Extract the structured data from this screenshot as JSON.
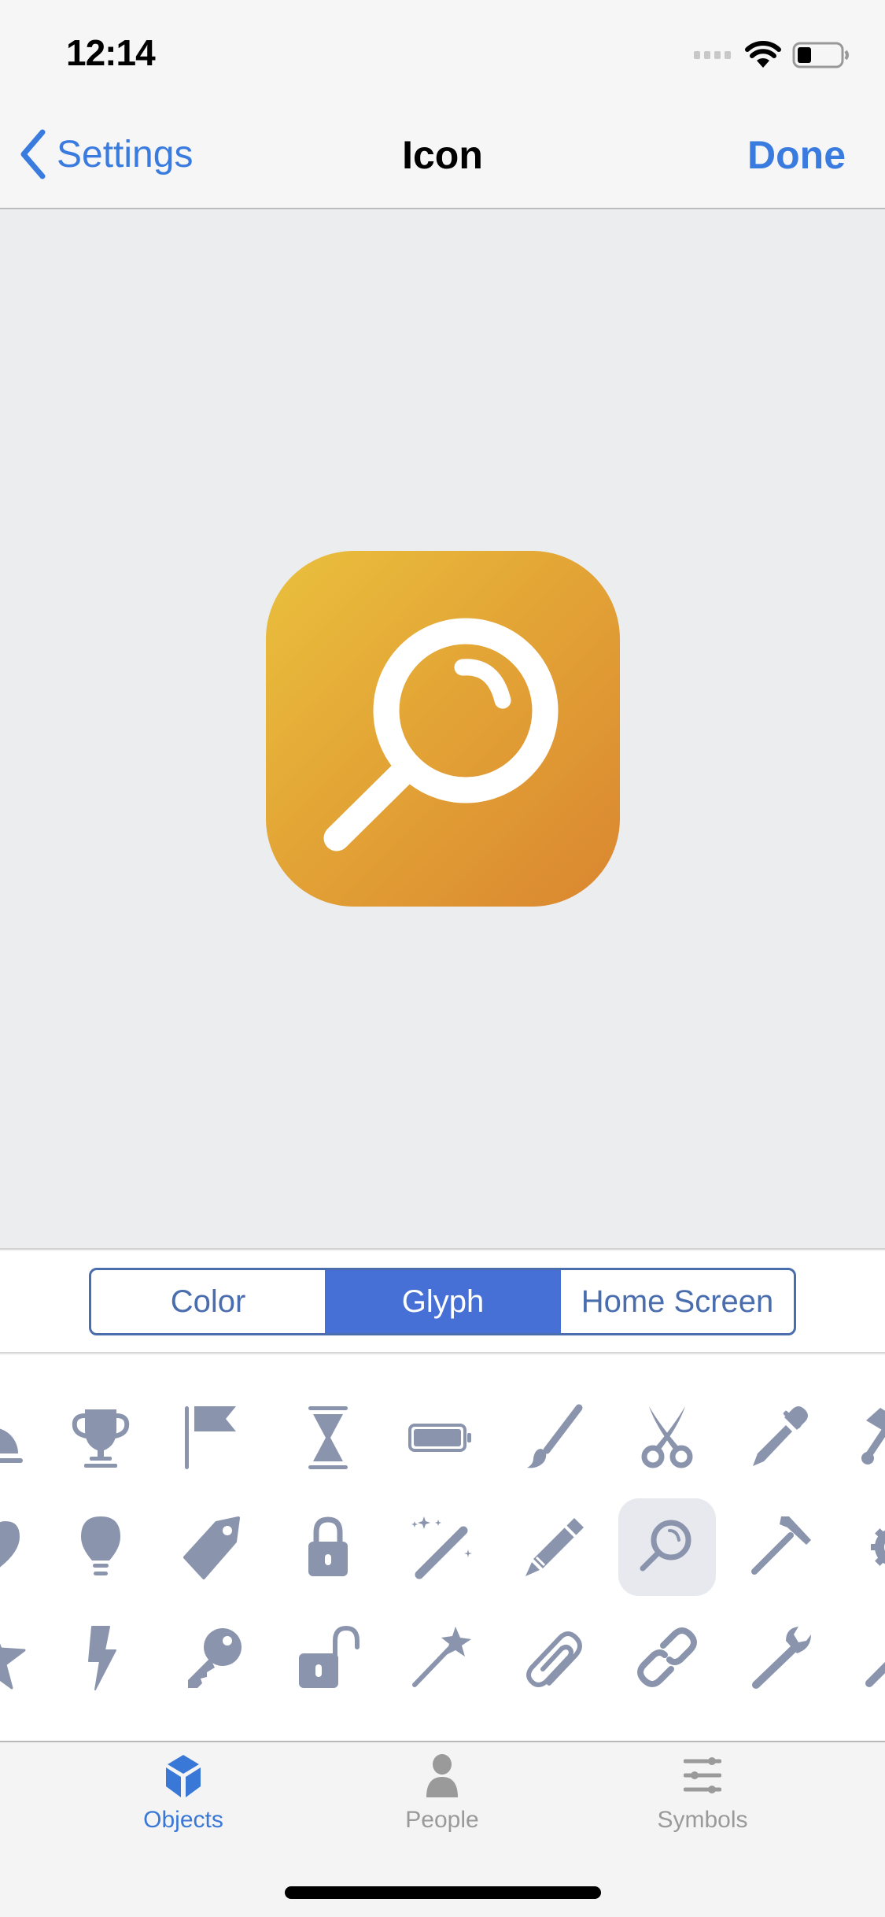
{
  "status_bar": {
    "time": "12:14",
    "signal_icon": "cellular-signal-icon",
    "wifi_icon": "wifi-icon",
    "battery_icon": "battery-icon",
    "battery_level_percent": 30
  },
  "nav": {
    "back_label": "Settings",
    "back_icon": "chevron-left-icon",
    "title": "Icon",
    "done_label": "Done"
  },
  "preview": {
    "glyph": "magnifying-glass-icon",
    "gradient_colors": [
      "#EAC03D",
      "#DA8630"
    ],
    "glyph_color": "#FFFFFF"
  },
  "segmented_control": {
    "options": [
      "Color",
      "Glyph",
      "Home Screen"
    ],
    "selected": "Glyph",
    "accent_color": "#4670D6"
  },
  "glyph_grid": {
    "glyph_color": "#8A95AD",
    "selected": "magnifying-glass",
    "rows": [
      [
        "service-bell",
        "trophy",
        "flag",
        "hourglass",
        "battery",
        "paintbrush",
        "scissors",
        "eyedropper",
        "hammer-partial"
      ],
      [
        "heart",
        "lightbulb",
        "tag",
        "lock",
        "magic-wand-sparkles",
        "pencil",
        "magnifying-glass",
        "hammer",
        "gear"
      ],
      [
        "star",
        "lightning-bolt",
        "key",
        "unlock",
        "magic-wand-star",
        "paperclip",
        "link",
        "wrench",
        "screwdriver"
      ]
    ]
  },
  "tab_bar": {
    "tabs": [
      {
        "label": "Objects",
        "icon": "cube-icon",
        "active": true
      },
      {
        "label": "People",
        "icon": "person-icon",
        "active": false
      },
      {
        "label": "Symbols",
        "icon": "sliders-icon",
        "active": false
      }
    ],
    "active_color": "#3A78D8",
    "inactive_color": "#9A9A9A"
  }
}
